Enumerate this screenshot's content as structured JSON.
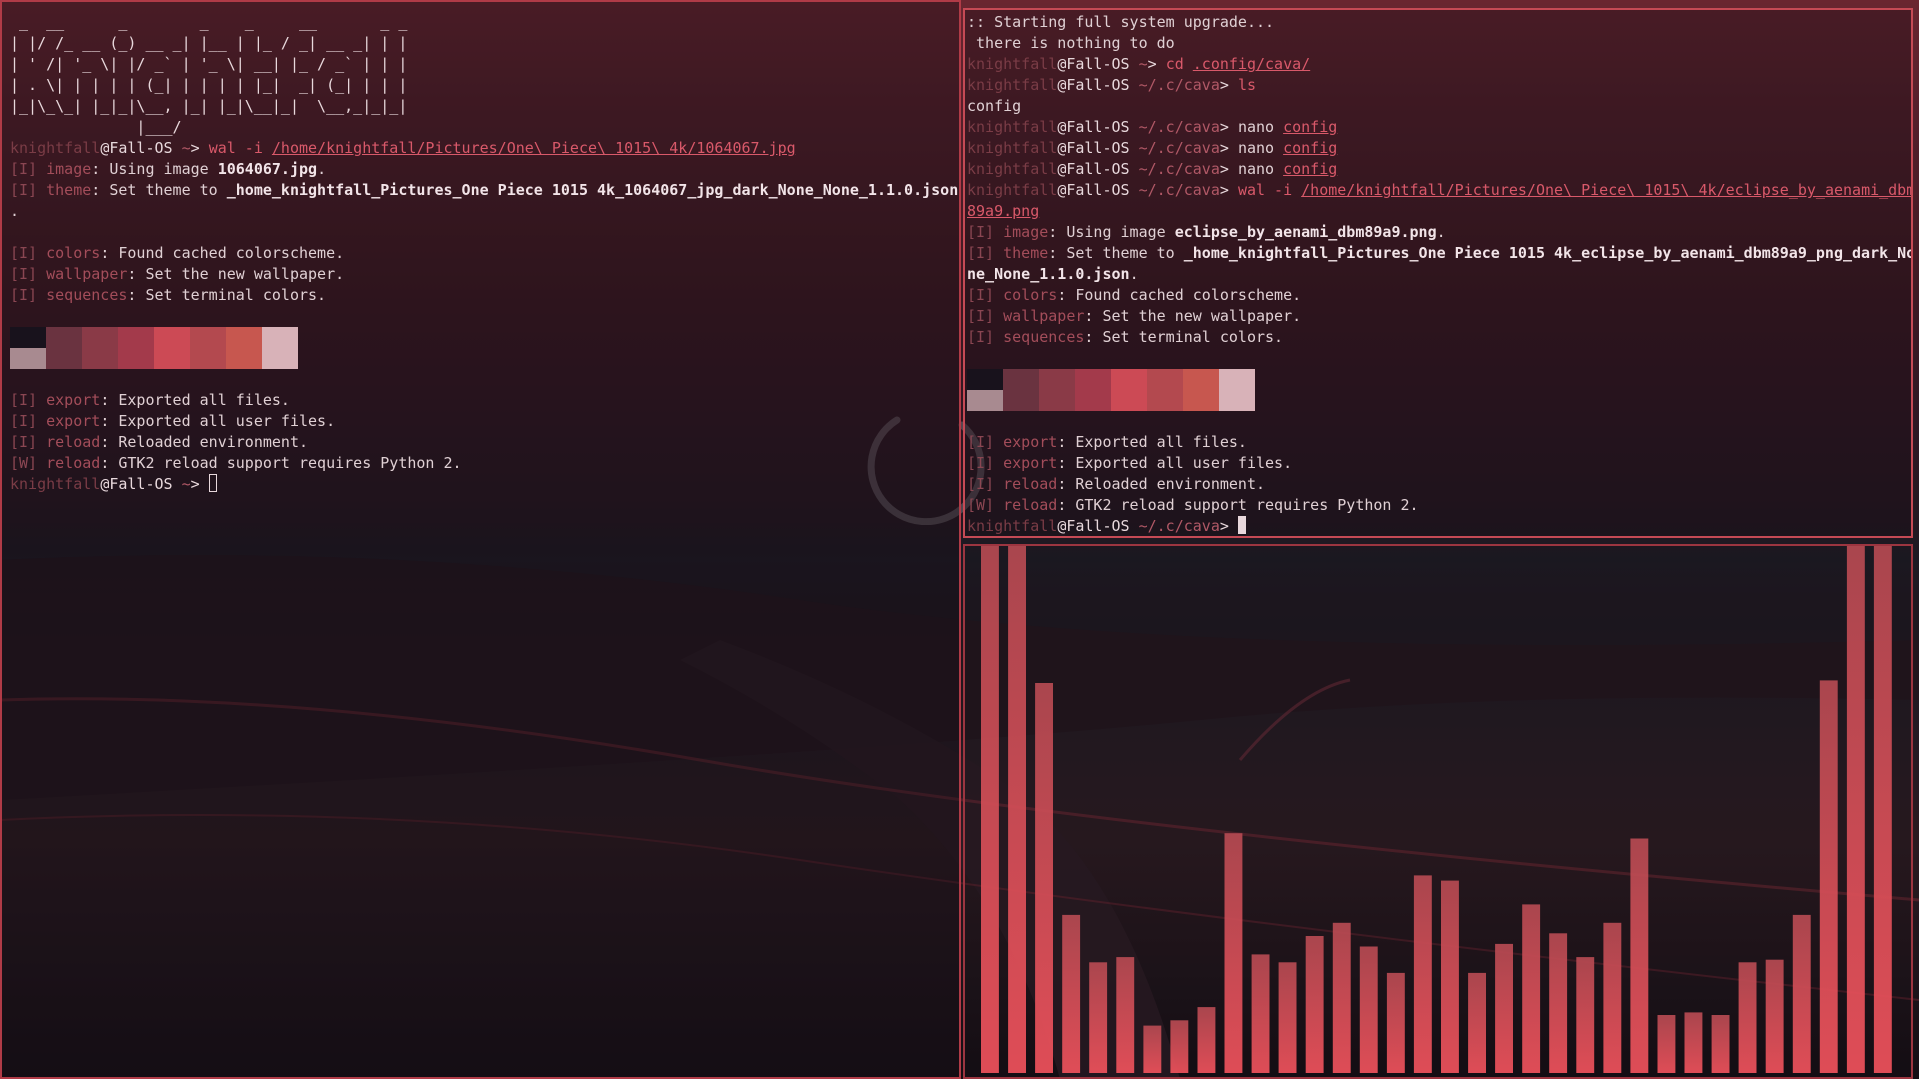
{
  "left_terminal": {
    "ascii_art": [
      " _  __      _        _    _     __       _ _ ",
      "| |/ /_ __ (_) __ _| |__ | |_ / _| __ _| | |",
      "| ' /| '_ \\| |/ _` | '_ \\| __| |_ / _` | | |",
      "| . \\| | | | | (_| | | | | |_|  _| (_| | | |",
      "|_|\\_\\_| |_|_|\\__, |_| |_|\\__|_|  \\__,_|_|_|",
      "              |___/                          "
    ],
    "prompt": {
      "user": "knightfall",
      "host": "@Fall-OS",
      "dir": " ~",
      "arrow": "> "
    },
    "command": {
      "name": "wal -i ",
      "arg": "/home/knightfall/Pictures/One\\ Piece\\ 1015\\ 4k/1064067.jpg"
    },
    "output_top": [
      {
        "tag": "[I] ",
        "key": "image",
        "sep": ": ",
        "text": "Using image ",
        "bold": "1064067.jpg",
        "tail": "."
      },
      {
        "tag": "[I] ",
        "key": "theme",
        "sep": ": ",
        "text": "Set theme to ",
        "bold": "_home_knightfall_Pictures_One Piece 1015 4k_1064067_jpg_dark_None_None_1.1.0.json",
        "tail": ""
      },
      {
        "tag": "",
        "key": "",
        "sep": "",
        "text": ".",
        "bold": "",
        "tail": ""
      },
      {
        "tag": "",
        "key": "",
        "sep": "",
        "text": "",
        "bold": "",
        "tail": ""
      },
      {
        "tag": "[I] ",
        "key": "colors",
        "sep": ": ",
        "text": "Found cached colorscheme.",
        "bold": "",
        "tail": ""
      },
      {
        "tag": "[I] ",
        "key": "wallpaper",
        "sep": ": ",
        "text": "Set the new wallpaper.",
        "bold": "",
        "tail": ""
      },
      {
        "tag": "[I] ",
        "key": "sequences",
        "sep": ": ",
        "text": "Set terminal colors.",
        "bold": "",
        "tail": ""
      }
    ],
    "output_bottom": [
      {
        "tag": "[I] ",
        "key": "export",
        "sep": ": ",
        "text": "Exported all files.",
        "bold": "",
        "tail": ""
      },
      {
        "tag": "[I] ",
        "key": "export",
        "sep": ": ",
        "text": "Exported all user files.",
        "bold": "",
        "tail": ""
      },
      {
        "tag": "[I] ",
        "key": "reload",
        "sep": ": ",
        "text": "Reloaded environment.",
        "bold": "",
        "tail": ""
      },
      {
        "tag": "[W] ",
        "key": "reload",
        "sep": ": ",
        "text": "GTK2 reload support requires Python 2.",
        "bold": "",
        "tail": ""
      }
    ]
  },
  "right_terminal": {
    "header": [
      ":: Starting full system upgrade...",
      " there is nothing to do"
    ],
    "history": [
      {
        "user": "knightfall",
        "host": "@Fall-OS",
        "dir": " ~",
        "arrow": "> ",
        "cmd": "cd ",
        "arg": ".config/cava/"
      },
      {
        "user": "knightfall",
        "host": "@Fall-OS",
        "dir": " ~/.c/cava",
        "arrow": "> ",
        "cmd": "ls",
        "arg": ""
      },
      {
        "output": "config"
      },
      {
        "user": "knightfall",
        "host": "@Fall-OS",
        "dir": " ~/.c/cava",
        "arrow": "> ",
        "cmd": "nano ",
        "arg": "config",
        "plaincmd": true
      },
      {
        "user": "knightfall",
        "host": "@Fall-OS",
        "dir": " ~/.c/cava",
        "arrow": "> ",
        "cmd": "nano ",
        "arg": "config",
        "plaincmd": true
      },
      {
        "user": "knightfall",
        "host": "@Fall-OS",
        "dir": " ~/.c/cava",
        "arrow": "> ",
        "cmd": "nano ",
        "arg": "config",
        "plaincmd": true
      },
      {
        "user": "knightfall",
        "host": "@Fall-OS",
        "dir": " ~/.c/cava",
        "arrow": "> ",
        "cmd": "wal -i ",
        "arg": "/home/knightfall/Pictures/One\\ Piece\\ 1015\\ 4k/eclipse_by_aenami_dbm",
        "wrap": true
      },
      {
        "argcont": "89a9.png"
      }
    ],
    "output_top": [
      {
        "tag": "[I] ",
        "key": "image",
        "sep": ": ",
        "text": "Using image ",
        "bold": "eclipse_by_aenami_dbm89a9.png",
        "tail": "."
      },
      {
        "tag": "[I] ",
        "key": "theme",
        "sep": ": ",
        "text": "Set theme to ",
        "bold": "_home_knightfall_Pictures_One Piece 1015 4k_eclipse_by_aenami_dbm89a9_png_dark_No",
        "tail": ""
      },
      {
        "tag": "",
        "key": "",
        "sep": "",
        "text": "",
        "bold": "ne_None_1.1.0.json",
        "tail": "."
      },
      {
        "tag": "[I] ",
        "key": "colors",
        "sep": ": ",
        "text": "Found cached colorscheme.",
        "bold": "",
        "tail": ""
      },
      {
        "tag": "[I] ",
        "key": "wallpaper",
        "sep": ": ",
        "text": "Set the new wallpaper.",
        "bold": "",
        "tail": ""
      },
      {
        "tag": "[I] ",
        "key": "sequences",
        "sep": ": ",
        "text": "Set terminal colors.",
        "bold": "",
        "tail": ""
      }
    ],
    "output_bottom": [
      {
        "tag": "[I] ",
        "key": "export",
        "sep": ": ",
        "text": "Exported all files.",
        "bold": "",
        "tail": ""
      },
      {
        "tag": "[I] ",
        "key": "export",
        "sep": ": ",
        "text": "Exported all user files.",
        "bold": "",
        "tail": ""
      },
      {
        "tag": "[I] ",
        "key": "reload",
        "sep": ": ",
        "text": "Reloaded environment.",
        "bold": "",
        "tail": ""
      },
      {
        "tag": "[W] ",
        "key": "reload",
        "sep": ": ",
        "text": "GTK2 reload support requires Python 2.",
        "bold": "",
        "tail": ""
      }
    ],
    "final_prompt": {
      "user": "knightfall",
      "host": "@Fall-OS",
      "dir": " ~/.c/cava",
      "arrow": "> "
    }
  },
  "palette": [
    "#18121c",
    "#6a3340",
    "#8a3a47",
    "#a33a4b",
    "#cc4a55",
    "#b3494f",
    "#c7574f",
    "#d8b2b8"
  ],
  "palette_first_bottom": "#a88a90",
  "cava": {
    "levels": [
      1.0,
      1.0,
      0.74,
      0.3,
      0.21,
      0.22,
      0.09,
      0.1,
      0.125,
      0.455,
      0.225,
      0.21,
      0.26,
      0.285,
      0.24,
      0.19,
      0.375,
      0.365,
      0.19,
      0.245,
      0.32,
      0.265,
      0.22,
      0.285,
      0.445,
      0.11,
      0.115,
      0.11,
      0.21,
      0.215,
      0.3,
      0.745,
      1.0,
      1.0
    ],
    "color_top": "#b64a52",
    "color_bottom": "#f0525c"
  },
  "colors": {
    "accent": "#c54a55",
    "text": "#e8d8dc",
    "dim": "#7a3c46"
  }
}
